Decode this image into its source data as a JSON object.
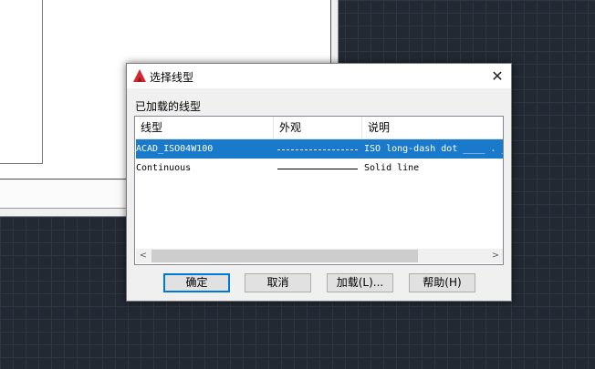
{
  "dialog": {
    "title": "选择线型",
    "close_symbol": "✕",
    "app_icon": "autocad-icon",
    "group_label": "已加载的线型"
  },
  "list": {
    "columns": [
      "线型",
      "外观",
      "说明"
    ],
    "rows": [
      {
        "linetype": "ACAD_ISO04W100",
        "appearance": "dashed",
        "description": "ISO long-dash dot ____ . ____ . ____ .",
        "selected": true
      },
      {
        "linetype": "Continuous",
        "appearance": "solid",
        "description": "Solid line",
        "selected": false
      }
    ],
    "scroll_left": "<",
    "scroll_right": ">"
  },
  "buttons": {
    "ok": "确定",
    "cancel": "取消",
    "load": "加载(L)...",
    "help": "帮助(H)"
  },
  "colors": {
    "selection": "#1979ca",
    "default_button_border": "#0078d7",
    "canvas_background": "#222933"
  }
}
